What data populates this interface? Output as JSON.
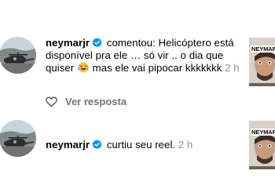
{
  "notifications": [
    {
      "username": "neymarjr",
      "verified": true,
      "action": "comentou:",
      "comment_part1": "Helicóptero está disponível pra ele … só vir .. o dia que quiser",
      "emoji": "rolling-on-floor-laughing-emoji",
      "comment_part2": "mas ele vai pipocar kkkkkkk",
      "time": "2 h",
      "thumbnail_caption": "NEYMAR PRO X",
      "reply_label": "Ver resposta"
    },
    {
      "username": "neymarjr",
      "verified": true,
      "action": "curtiu seu reel.",
      "time": "2 h",
      "thumbnail_caption": "NEYMAR PRO X"
    }
  ],
  "colors": {
    "verified_badge": "#0095f6",
    "secondary_text": "#8e8e8e",
    "background": "#ffffff"
  }
}
